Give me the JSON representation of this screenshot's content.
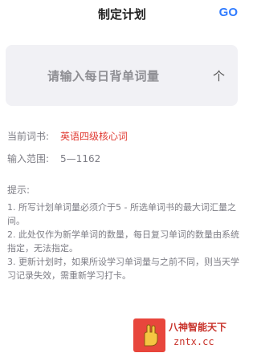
{
  "header": {
    "title": "制定计划",
    "go_label": "GO"
  },
  "input": {
    "placeholder": "请输入每日背单词量",
    "unit": "个"
  },
  "info": {
    "wordbook_label": "当前词书:",
    "wordbook_value": "英语四级核心词",
    "range_label": "输入范围:",
    "range_value": "5—1162"
  },
  "tips": {
    "title": "提示:",
    "items": [
      "1. 所写计划单词量必须介于5 - 所选单词书的最大词汇量之间。",
      "2. 此处仅作为新学单词的数量，每日复习单词的数量由系统指定，无法指定。",
      "3. 更新计划时，如果所设学习单词量与之前不同，则当天学习记录失效，需重新学习打卡。"
    ]
  },
  "watermark": {
    "line1": "八神智能天下",
    "line2": "zntx.cc"
  },
  "colors": {
    "accent": "#2f7bff",
    "highlight": "#e03a32",
    "card_bg": "#f1f1f5",
    "muted_text": "#7d7d85"
  }
}
